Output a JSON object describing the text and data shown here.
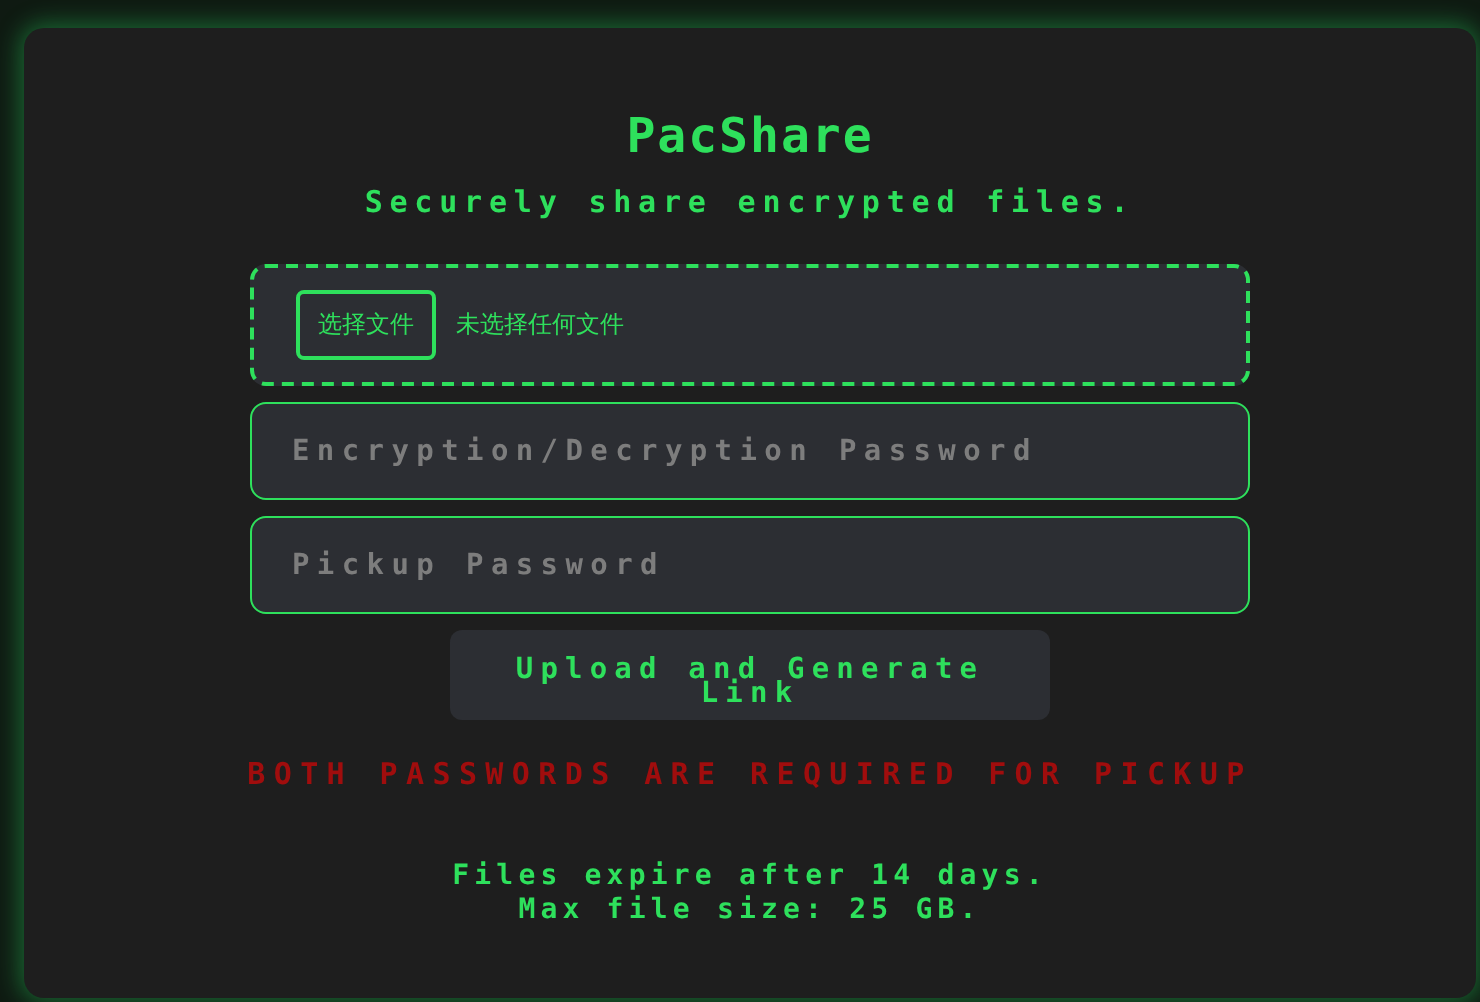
{
  "title": "PacShare",
  "subtitle": "Securely share encrypted files.",
  "file_input": {
    "button": "选择文件",
    "status": "未选择任何文件"
  },
  "fields": [
    {
      "placeholder": "Encryption/Decryption Password"
    },
    {
      "placeholder": "Pickup Password"
    }
  ],
  "upload_button": "Upload and Generate Link",
  "warning": "BOTH PASSWORDS ARE REQUIRED FOR PICKUP",
  "notes": [
    "Files expire after 14 days.",
    "Max file size: 25 GB."
  ]
}
